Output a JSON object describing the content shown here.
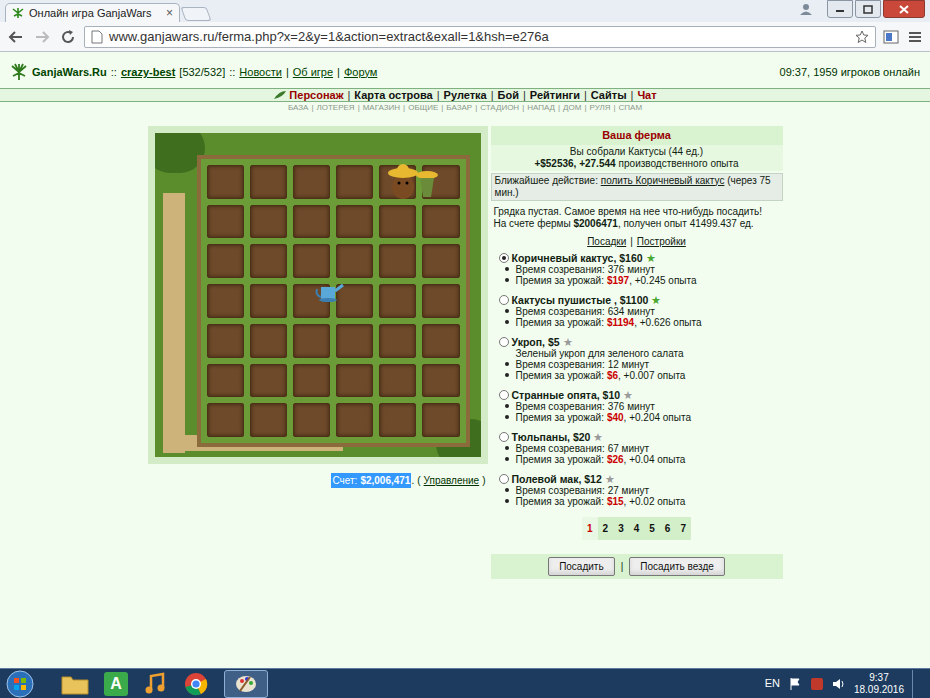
{
  "browser": {
    "tab_title": "Онлайн игра GanjaWars",
    "tab_close": "×",
    "url": "www.ganjawars.ru/ferma.php?x=2&y=1&action=extract&exall=1&hsh=e276a"
  },
  "header": {
    "logo": "GanjaWars.Ru",
    "sep1": "::",
    "user": "crazy-best",
    "level": "[532/532]",
    "sep2": "::",
    "links": [
      "Новости",
      "Об игре",
      "Форум"
    ],
    "link_sep": "|",
    "status": "09:37, 1959 игроков онлайн"
  },
  "nav": {
    "items": [
      {
        "label": "Персонаж",
        "highlight": true
      },
      {
        "label": "Карта острова",
        "highlight": false
      },
      {
        "label": "Рулетка",
        "highlight": false
      },
      {
        "label": "Бой",
        "highlight": false
      },
      {
        "label": "Рейтинги",
        "highlight": false
      },
      {
        "label": "Сайты",
        "highlight": false
      },
      {
        "label": "Чат",
        "highlight": true
      }
    ],
    "sep": "|"
  },
  "subnav": {
    "items": [
      "БАЗА",
      "ЛОТЕРЕЯ",
      "МАГАЗИН",
      "ОБЩИЕ",
      "БАЗАР",
      "СТАДИОН",
      "НАПАД",
      "ДОМ",
      "РУЛЯ",
      "СПАМ"
    ],
    "sep": "|"
  },
  "farm": {
    "score": {
      "label": "Счет:",
      "amount": "$2,006,471",
      "selected": true
    },
    "score_end": ".",
    "open": "(",
    "manage": "Управление",
    "close": ")"
  },
  "panel": {
    "title": "Ваша ферма",
    "harvest": "Вы собрали Кактусы (44 ед.)",
    "gain": "+$52536, +27.544",
    "gain_suffix": "производственного опыта",
    "next_label": "Ближайшее действие:",
    "next_link": "полить Коричневый кактус",
    "next_suffix": "(через 75 мин.)",
    "empty_text": "Грядка пустая. Самое время на нее что-нибудь посадить!",
    "account_prefix": "На счете фермы",
    "account": "$2006471",
    "account_suffix": ", получен опыт 41499.437 ед.",
    "tabs": [
      "Посадки",
      "Постройки"
    ],
    "tab_sep": "|",
    "time_label": "Время созревания:",
    "reward_label": "Премия за урожай:",
    "plants": [
      {
        "name": "Коричневый кактус, $160",
        "star": "★",
        "star_color": "#4aa82e",
        "selected": true,
        "time": "376 минут",
        "reward": "$197",
        "exp": ", +0.245 опыта"
      },
      {
        "name": "Кактусы пушистые , $1100",
        "star": "★",
        "star_color": "#4aa82e",
        "selected": false,
        "time": "634 минут",
        "reward": "$1194",
        "exp": ", +0.626 опыта"
      },
      {
        "name": "Укроп, $5",
        "star": "★",
        "star_color": "#9a9a9a",
        "selected": false,
        "desc": "Зеленый укроп для зеленого салата",
        "time": "12 минут",
        "reward": "$6",
        "exp": ", +0.007 опыта"
      },
      {
        "name": "Странные опята, $10",
        "star": "★",
        "star_color": "#9a9a9a",
        "selected": false,
        "time": "376 минут",
        "reward": "$40",
        "exp": ", +0.204 опыта"
      },
      {
        "name": "Тюльпаны, $20",
        "star": "★",
        "star_color": "#9a9a9a",
        "selected": false,
        "time": "67 минут",
        "reward": "$26",
        "exp": ", +0.04 опыта"
      },
      {
        "name": "Полевой мак, $12",
        "star": "★",
        "star_color": "#9a9a9a",
        "selected": false,
        "time": "27 минут",
        "reward": "$15",
        "exp": ", +0.02 опыта"
      }
    ],
    "pages": [
      {
        "label": "1",
        "selected": true
      },
      {
        "label": "2",
        "selected": false
      },
      {
        "label": "3",
        "selected": false
      },
      {
        "label": "4",
        "selected": false
      },
      {
        "label": "5",
        "selected": false
      },
      {
        "label": "6",
        "selected": false
      },
      {
        "label": "7",
        "selected": false
      }
    ],
    "buttons": [
      "Посадить",
      "Посадить везде"
    ],
    "button_sep": "|"
  },
  "taskbar": {
    "app_letter": "A",
    "lang": "EN",
    "time": "9:37",
    "date": "18.09.2016"
  }
}
